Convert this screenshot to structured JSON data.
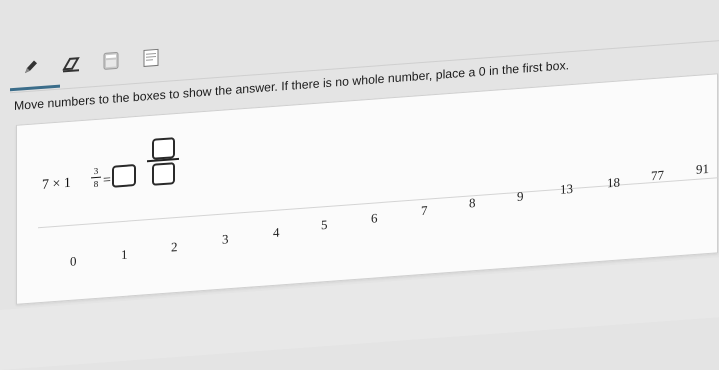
{
  "toolbar": {
    "tools": [
      {
        "icon": "pencil-icon"
      },
      {
        "icon": "eraser-icon"
      },
      {
        "icon": "calculator-icon"
      },
      {
        "icon": "notepad-icon"
      }
    ]
  },
  "instruction": "Move numbers to the boxes to show the answer. If there is no whole number, place a 0 in the first box.",
  "expression": {
    "lhs": "7 × 1",
    "frac_num": "3",
    "frac_den": "8",
    "equals": "="
  },
  "tiles": [
    "0",
    "1",
    "2",
    "3",
    "4",
    "5",
    "6",
    "7",
    "8",
    "9",
    "13",
    "18",
    "77",
    "91"
  ]
}
